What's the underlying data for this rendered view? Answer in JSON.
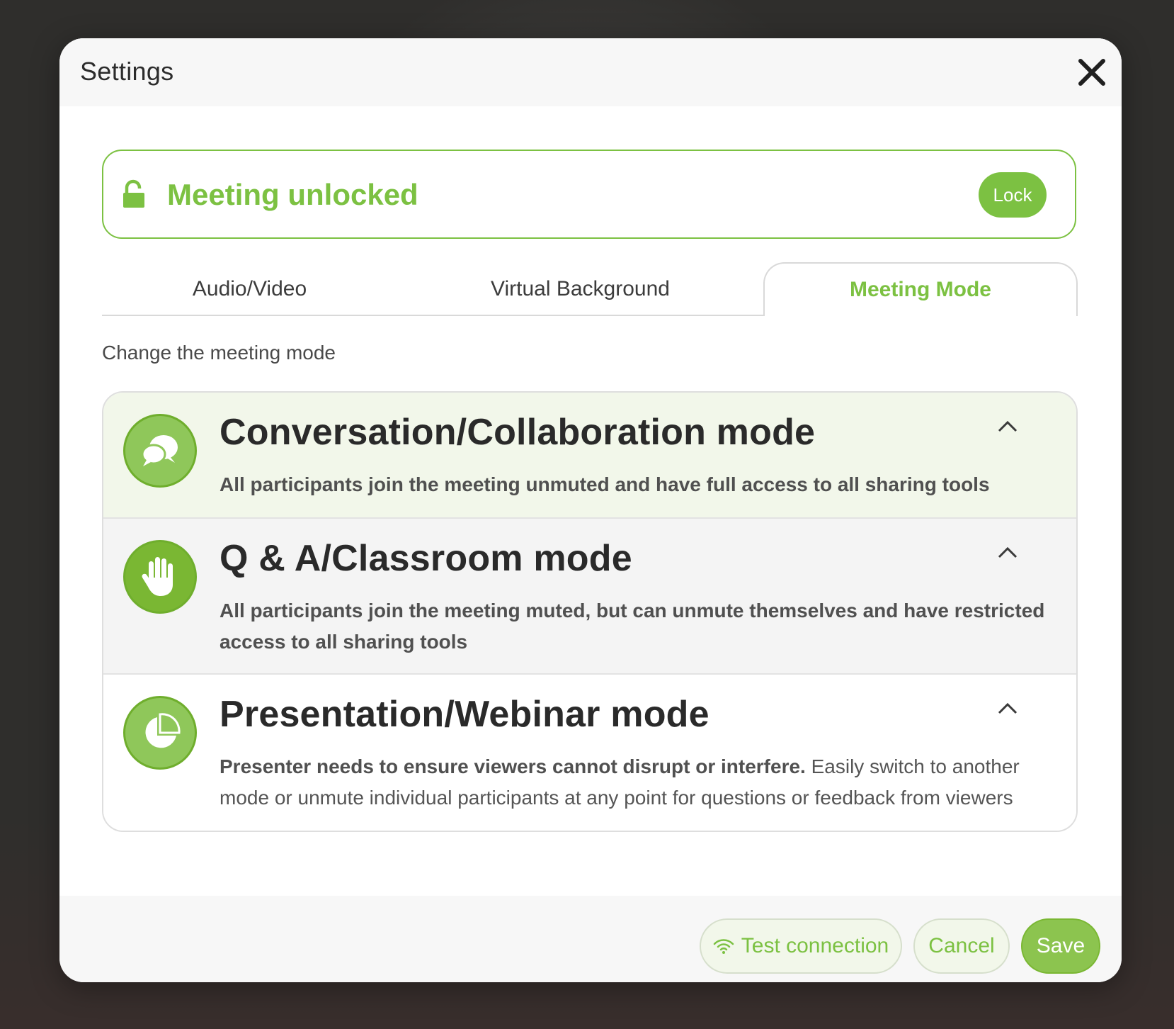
{
  "dialog": {
    "title": "Settings"
  },
  "lock": {
    "status": "Meeting unlocked",
    "button_label": "Lock"
  },
  "tabs": [
    {
      "label": "Audio/Video",
      "active": false
    },
    {
      "label": "Virtual Background",
      "active": false
    },
    {
      "label": "Meeting Mode",
      "active": true
    }
  ],
  "section": {
    "subtitle": "Change the meeting mode"
  },
  "modes": [
    {
      "title": "Conversation/Collaboration mode",
      "description_bold": "All participants join the meeting unmuted and have full access to all sharing tools",
      "description": "",
      "icon": "chat-bubbles-icon",
      "selected": true
    },
    {
      "title": "Q & A/Classroom mode",
      "description_bold": "All participants join the meeting muted, but can unmute themselves and have restricted access to all sharing tools",
      "description": "",
      "icon": "raised-hand-icon",
      "selected": false
    },
    {
      "title": "Presentation/Webinar mode",
      "description_bold": "Presenter needs to ensure viewers cannot disrupt or interfere.",
      "description": " Easily switch to another mode or unmute individual participants at any point for questions or feedback from viewers",
      "icon": "pie-chart-icon",
      "selected": false
    }
  ],
  "footer": {
    "test_connection_label": "Test connection",
    "cancel_label": "Cancel",
    "save_label": "Save"
  },
  "colors": {
    "accent": "#7cc142",
    "selected_row": "#f2f7ea",
    "hover_row": "#f4f4f4"
  }
}
